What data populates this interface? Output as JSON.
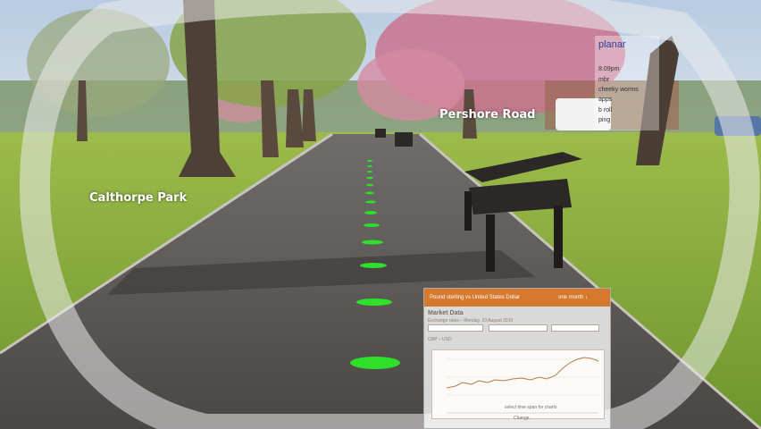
{
  "overlay": {
    "park_label": "Calthorpe Park",
    "road_label": "Pershore Road"
  },
  "status_panel": {
    "title": "planar",
    "lines": [
      "8.09pm",
      "mbr",
      "cheeky worms",
      "apps",
      "b roll",
      "ping"
    ]
  },
  "market": {
    "title_bar_left": "Pound sterling vs United States Dollar",
    "title_bar_right": "one month ↓",
    "heading": "Market Data",
    "subtitle": "Exchange rates – Monday, 23 August 2010",
    "tab_line": "GBP – USD",
    "foot_left": "select time span for charts",
    "foot_mid": "Change"
  },
  "colors": {
    "market_bar": "#d4792e",
    "path_dots": "#2ee02a",
    "status_title": "#2c3e9e"
  }
}
